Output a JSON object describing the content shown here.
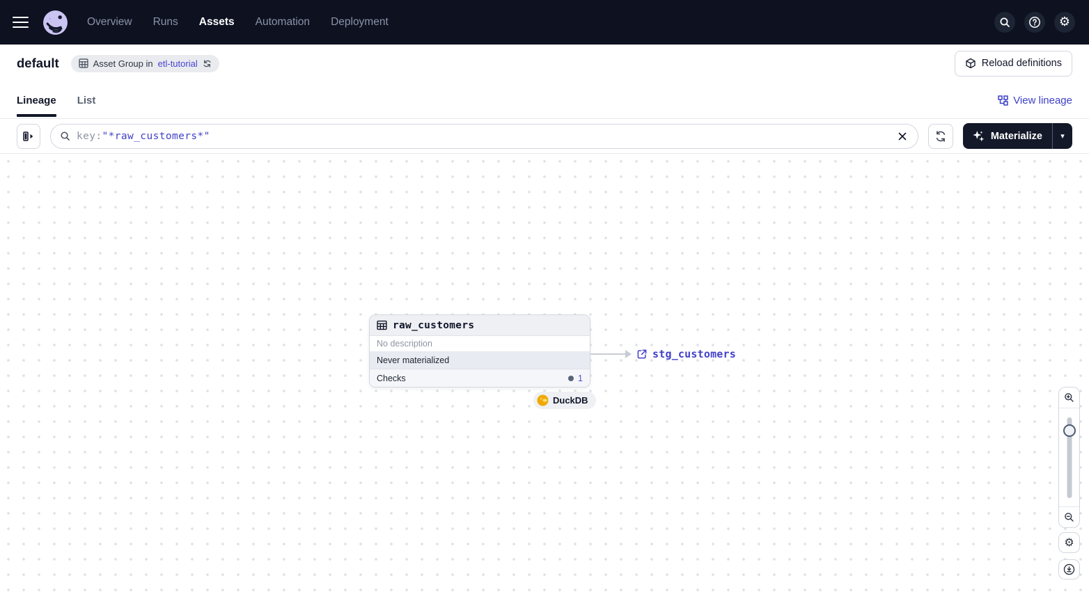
{
  "colors": {
    "navbar_bg": "#0d1120",
    "link_accent": "#3d3fc8",
    "mono_value": "#4240c8",
    "materialize_bg": "#131929",
    "duckdb_yellow": "#efaa01",
    "status_row_bg": "#e8ebf1"
  },
  "icons": {
    "gear_glyph": "⚙",
    "caret_down": "▾",
    "help_glyph": "?"
  },
  "navbar": {
    "items": [
      {
        "label": "Overview"
      },
      {
        "label": "Runs"
      },
      {
        "label": "Assets"
      },
      {
        "label": "Automation"
      },
      {
        "label": "Deployment"
      }
    ]
  },
  "header": {
    "title": "default",
    "badge_text": "Asset Group in",
    "badge_link": "etl-tutorial",
    "reload_label": "Reload definitions"
  },
  "tabs": {
    "items": [
      {
        "label": "Lineage"
      },
      {
        "label": "List"
      }
    ],
    "view_lineage_label": "View lineage"
  },
  "filter_bar": {
    "query_prefix": "key:",
    "query_value": "\"*raw_customers*\"",
    "materialize_label": "Materialize"
  },
  "graph": {
    "node": {
      "title": "raw_customers",
      "description": "No description",
      "status": "Never materialized",
      "checks_label": "Checks",
      "checks_count": "1",
      "storage_badge": "DuckDB"
    },
    "downstream": {
      "label": "stg_customers"
    }
  }
}
